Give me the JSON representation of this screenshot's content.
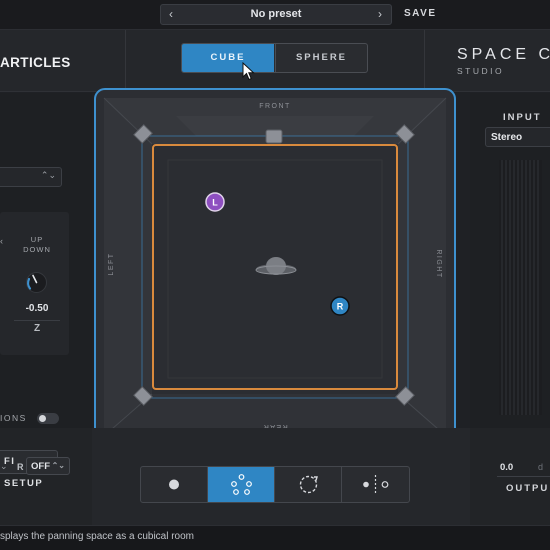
{
  "preset_bar": {
    "prev_icon": "chevron-left-icon",
    "next_icon": "chevron-right-icon",
    "preset_name": "No preset",
    "save_label": "SAVE"
  },
  "header": {
    "logo_text": "ARTICLES",
    "mode_tabs": [
      {
        "label": "CUBE",
        "active": true
      },
      {
        "label": "SPHERE",
        "active": false
      }
    ],
    "brand_title": "SPACE CO",
    "brand_subtitle": "STUDIO"
  },
  "left_panel": {
    "axis_label": "UP\nDOWN",
    "left_edge_char": "‹",
    "knob_value": "-0.50",
    "axis": "Z",
    "options_label": "IONS",
    "options_toggle_on": false
  },
  "bottom_left": {
    "setup_label": "FI SETUP",
    "r_label": "R",
    "r_value": "OFF"
  },
  "right_panel": {
    "input_label": "INPUT",
    "input_mode": "Stereo",
    "output_value": "0.0",
    "output_unit_hint": "d",
    "output_label": "OUTPU"
  },
  "cube": {
    "labels": {
      "front": "FRONT",
      "rear": "REAR",
      "left": "LEFT",
      "right": "RIGHT"
    },
    "sources": [
      {
        "label": "L",
        "color": "#8e4fc0"
      },
      {
        "label": "R",
        "color": "#2f86c4"
      }
    ],
    "accent_color": "#3e91cf",
    "room_outline_color": "#d98a3d"
  },
  "view_buttons": [
    {
      "icon": "dot-icon",
      "active": false
    },
    {
      "icon": "speakers-icon",
      "active": true
    },
    {
      "icon": "rotate-icon",
      "active": false
    },
    {
      "icon": "mirror-icon",
      "active": false
    }
  ],
  "status": {
    "text": "splays the panning space as a cubical room"
  }
}
